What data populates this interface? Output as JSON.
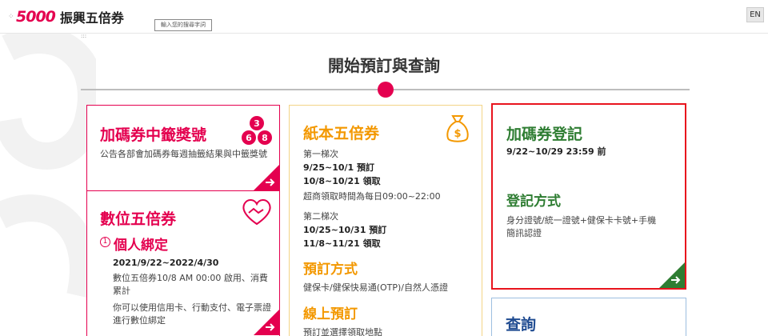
{
  "header": {
    "logo_number": "5000",
    "logo_name": "振興五倍券",
    "search_placeholder": "輸入您的搜尋字詞",
    "lang_button": "EN",
    "skip_dots": ":::"
  },
  "main": {
    "title": "開始預訂與查詢"
  },
  "cards": {
    "lottery": {
      "title": "加碼券中籤獎號",
      "badge_numbers": [
        "3",
        "6",
        "8"
      ],
      "desc": "公告各部會加碼券每週抽籤結果與中籤獎號"
    },
    "digital": {
      "title": "數位五倍券",
      "step_number": "1",
      "step_title": "個人綁定",
      "date": "2021/9/22~2022/4/30",
      "line1": "數位五倍券10/8 AM 00:00 啟用、消費累計",
      "line2": "你可以使用信用卡、行動支付、電子票證進行數位綁定"
    },
    "paper": {
      "title": "紙本五倍券",
      "batch1_label": "第一梯次",
      "batch1_reserve": "9/25~10/1 預訂",
      "batch1_pickup": "10/8~10/21 領取",
      "store_hours": "超商領取時間為每日09:00~22:00",
      "batch2_label": "第二梯次",
      "batch2_reserve": "10/25~10/31 預訂",
      "batch2_pickup": "11/8~11/21 領取",
      "method_title": "預訂方式",
      "method_text": "健保卡/健保快易通(OTP)/自然人憑證",
      "online_title": "線上預訂",
      "online_text": "預訂並選擇領取地點"
    },
    "register": {
      "title": "加碼券登記",
      "period": "9/22~10/29 23:59 前",
      "method_title": "登記方式",
      "method_text": "身分證號/統一證號+健保卡卡號+手機簡訊認證"
    },
    "query": {
      "title": "查詢"
    }
  },
  "colors": {
    "pink": "#e4004f",
    "orange": "#f39800",
    "green": "#2e7d32",
    "blue": "#1f4b91",
    "highlight_border": "#e8141d"
  }
}
